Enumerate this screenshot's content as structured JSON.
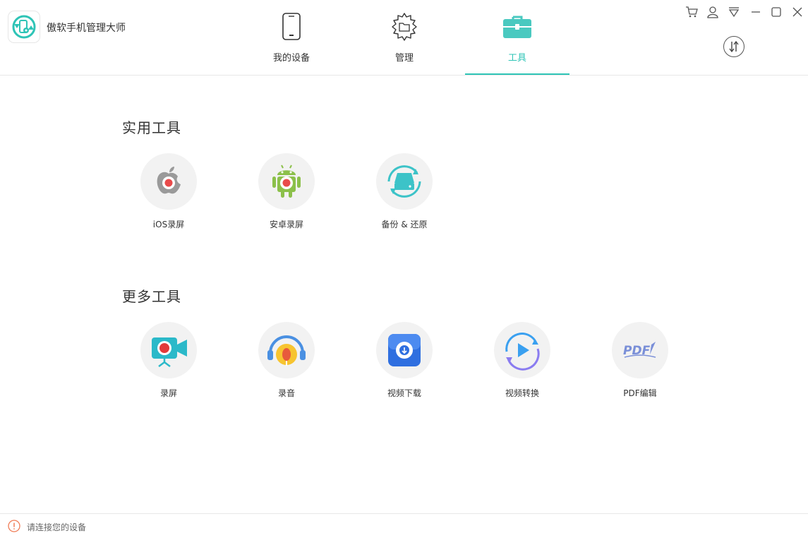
{
  "app": {
    "title": "傲软手机管理大师"
  },
  "nav": {
    "tabs": [
      {
        "label": "我的设备",
        "icon": "phone-icon"
      },
      {
        "label": "管理",
        "icon": "gear-folder-icon"
      },
      {
        "label": "工具",
        "icon": "toolbox-icon",
        "active": true
      }
    ]
  },
  "window_controls": [
    "cart-icon",
    "user-icon",
    "menu-icon",
    "minimize-icon",
    "maximize-icon",
    "close-icon"
  ],
  "sections": {
    "practical": {
      "title": "实用工具",
      "tools": [
        {
          "label": "iOS录屏",
          "icon": "apple-record-icon"
        },
        {
          "label": "安卓录屏",
          "icon": "android-record-icon"
        },
        {
          "label": "备份 & 还原",
          "icon": "backup-restore-icon"
        }
      ]
    },
    "more": {
      "title": "更多工具",
      "tools": [
        {
          "label": "录屏",
          "icon": "camera-record-icon"
        },
        {
          "label": "录音",
          "icon": "microphone-icon"
        },
        {
          "label": "视频下载",
          "icon": "video-download-icon"
        },
        {
          "label": "视频转换",
          "icon": "video-convert-icon"
        },
        {
          "label": "PDF编辑",
          "icon": "pdf-edit-icon"
        }
      ]
    }
  },
  "status": {
    "text": "请连接您的设备"
  },
  "colors": {
    "accent": "#2ec4b6",
    "warning": "#f07b55"
  }
}
